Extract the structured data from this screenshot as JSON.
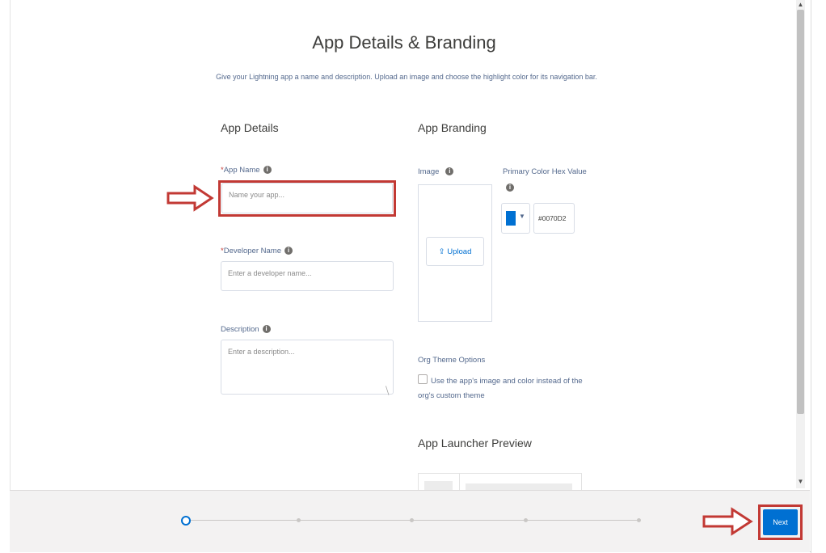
{
  "header": {
    "title": "App Details & Branding",
    "subtitle": "Give your Lightning app a name and description. Upload an image and choose the highlight color for its navigation bar."
  },
  "app_details": {
    "heading": "App Details",
    "app_name": {
      "required_mark": "*",
      "label": "App Name",
      "placeholder": "Name your app..."
    },
    "developer_name": {
      "required_mark": "*",
      "label": "Developer Name",
      "placeholder": "Enter a developer name..."
    },
    "description": {
      "label": "Description",
      "placeholder": "Enter a description..."
    }
  },
  "app_branding": {
    "heading": "App Branding",
    "image_label": "Image",
    "upload_label": "Upload",
    "primary_color_label": "Primary Color Hex Value",
    "primary_color_value": "#0070D2",
    "swatch_color": "#0070d2",
    "org_theme_heading": "Org Theme Options",
    "org_theme_checkbox_label": "Use the app's image and color instead of the org's custom theme",
    "launcher_preview_heading": "App Launcher Preview"
  },
  "footer": {
    "next_label": "Next",
    "steps_total": 5,
    "current_step": 1
  },
  "colors": {
    "accent": "#0070d2",
    "highlight": "#c23934"
  }
}
